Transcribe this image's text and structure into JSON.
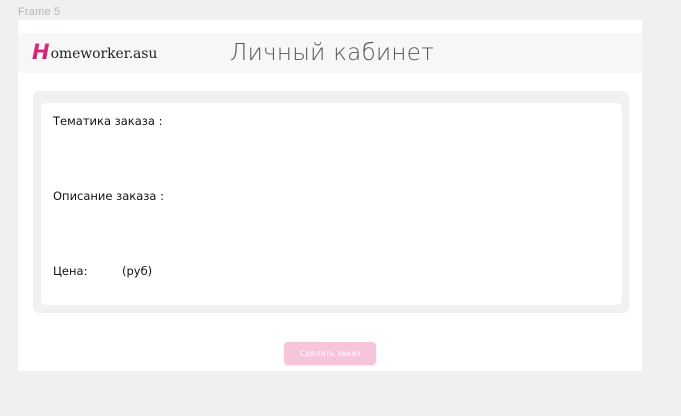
{
  "canvas": {
    "frame_label": "Frame 5"
  },
  "header": {
    "logo_initial": "H",
    "logo_text": "omeworker.asu",
    "title": "Личный кабинет"
  },
  "form": {
    "topic_label": "Тематика заказа :",
    "description_label": "Описание заказа :",
    "price_label": "Цена:",
    "price_unit": "(руб)"
  },
  "actions": {
    "submit_label": "Сделать заказ"
  },
  "colors": {
    "brand": "#d6267a",
    "button": "#f6c4db",
    "canvas_bg": "#f0f0f0",
    "panel_bg": "#f1f1f1"
  }
}
